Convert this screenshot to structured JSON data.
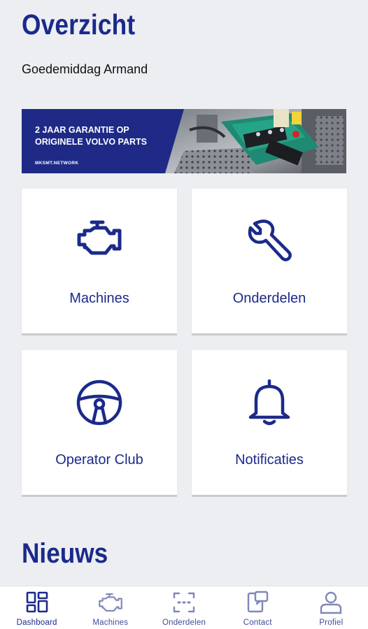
{
  "header": {
    "title": "Overzicht",
    "greeting": "Goedemiddag Armand"
  },
  "banner": {
    "headline": "2 JAAR GARANTIE OP\nORIGINELE VOLVO PARTS",
    "url": "MKSMT.NETWORK",
    "image": "engine-photo"
  },
  "tiles": [
    {
      "label": "Machines",
      "icon": "engine-icon"
    },
    {
      "label": "Onderdelen",
      "icon": "wrench-icon"
    },
    {
      "label": "Operator Club",
      "icon": "steering-wheel-icon"
    },
    {
      "label": "Notificaties",
      "icon": "bell-icon"
    }
  ],
  "news": {
    "title": "Nieuws"
  },
  "bottom_nav": [
    {
      "label": "Dashboard",
      "icon": "dashboard-grid-icon",
      "active": true
    },
    {
      "label": "Machines",
      "icon": "engine-icon",
      "active": false
    },
    {
      "label": "Onderdelen",
      "icon": "scan-icon",
      "active": false
    },
    {
      "label": "Contact",
      "icon": "contact-icon",
      "active": false
    },
    {
      "label": "Profiel",
      "icon": "person-icon",
      "active": false
    }
  ],
  "colors": {
    "brand": "#1b2a8a",
    "background": "#eceef2",
    "tile": "#ffffff"
  }
}
